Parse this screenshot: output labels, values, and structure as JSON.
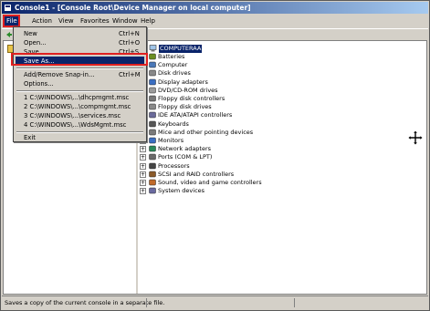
{
  "window": {
    "title": "Console1 - [Console Root\\Device Manager on local computer]"
  },
  "menubar": {
    "items": [
      "File",
      "Action",
      "View",
      "Favorites",
      "Window",
      "Help"
    ]
  },
  "file_menu": {
    "items": [
      {
        "label": "New",
        "shortcut": "Ctrl+N"
      },
      {
        "label": "Open...",
        "shortcut": "Ctrl+O"
      },
      {
        "label": "Save",
        "shortcut": "Ctrl+S"
      },
      {
        "label": "Save As...",
        "shortcut": ""
      },
      {
        "label": "Add/Remove Snap-in...",
        "shortcut": "Ctrl+M"
      },
      {
        "label": "Options...",
        "shortcut": ""
      },
      {
        "label": "1 C:\\WINDOWS\\...\\dhcpmgmt.msc",
        "shortcut": ""
      },
      {
        "label": "2 C:\\WINDOWS\\...\\compmgmt.msc",
        "shortcut": ""
      },
      {
        "label": "3 C:\\WINDOWS\\...\\services.msc",
        "shortcut": ""
      },
      {
        "label": "4 C:\\WINDOWS\\...\\WdsMgmt.msc",
        "shortcut": ""
      },
      {
        "label": "Exit",
        "shortcut": ""
      }
    ],
    "selected": "Save As..."
  },
  "device_tree": {
    "root": "COMPUTERAA",
    "items": [
      "Batteries",
      "Computer",
      "Disk drives",
      "Display adapters",
      "DVD/CD-ROM drives",
      "Floppy disk controllers",
      "Floppy disk drives",
      "IDE ATA/ATAPI controllers",
      "Keyboards",
      "Mice and other pointing devices",
      "Monitors",
      "Network adapters",
      "Ports (COM & LPT)",
      "Processors",
      "SCSI and RAID controllers",
      "Sound, video and game controllers",
      "System devices"
    ]
  },
  "statusbar": {
    "text": "Saves a copy of the current console in a separate file."
  },
  "colors": {
    "title_bar": "#0a246a",
    "highlight": "#0a246a",
    "annotation": "#e02020",
    "chrome": "#d4d0c8"
  }
}
